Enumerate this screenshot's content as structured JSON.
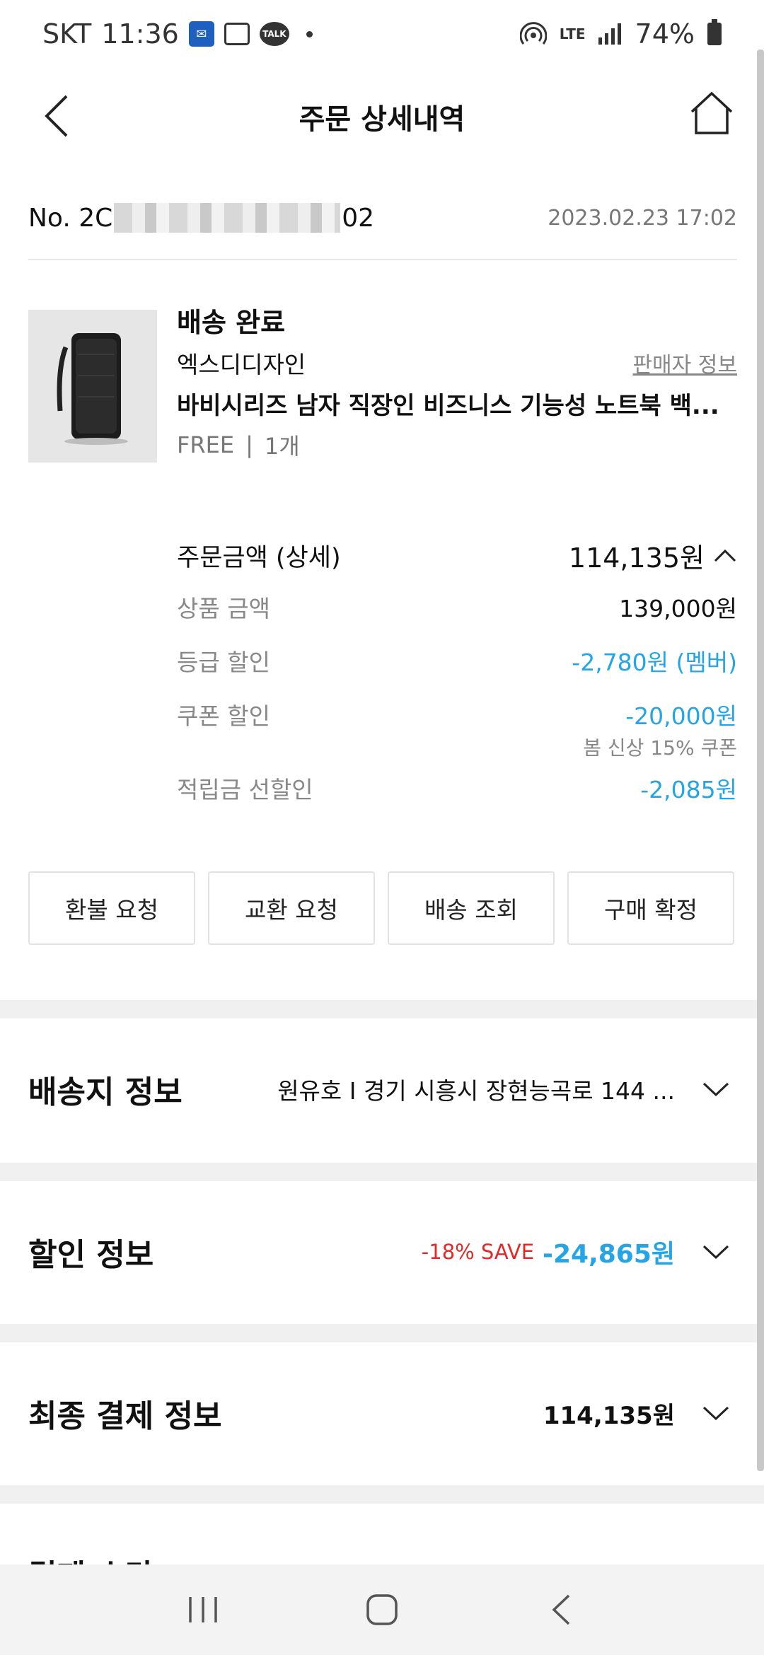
{
  "status_bar": {
    "carrier": "SKT",
    "time": "11:36",
    "talk_icon_label": "TALK",
    "network": "LTE",
    "battery": "74%"
  },
  "header": {
    "title": "주문 상세내역"
  },
  "order": {
    "number_prefix": "No. 2C",
    "number_suffix": "02",
    "date": "2023.02.23 17:02"
  },
  "product": {
    "status": "배송 완료",
    "brand": "엑스디디자인",
    "seller_link": "판매자 정보",
    "name": "바비시리즈 남자 직장인 비즈니스 기능성 노트북 백...",
    "option": "FREE",
    "separator": "|",
    "quantity": "1개"
  },
  "prices": {
    "order_amount_label": "주문금액 (상세)",
    "order_amount_value": "114,135원",
    "items": [
      {
        "label": "상품 금액",
        "value": "139,000원"
      },
      {
        "label": "등급 할인",
        "value": "-2,780원 (멤버)"
      },
      {
        "label": "쿠폰 할인",
        "value": "-20,000원"
      },
      {
        "label": "적립금 선할인",
        "value": "-2,085원"
      }
    ],
    "coupon_note": "봄 신상 15% 쿠폰"
  },
  "actions": [
    "환불 요청",
    "교환 요청",
    "배송 조회",
    "구매 확정"
  ],
  "sections": {
    "shipping": {
      "title": "배송지 정보",
      "value": "원유호  I  경기 시흥시 장현능곡로 144 ..."
    },
    "discount": {
      "title": "할인 정보",
      "save_tag": "-18% SAVE",
      "save_amount": "-24,865원"
    },
    "final_payment": {
      "title": "최종 결제 정보",
      "value": "114,135원"
    },
    "next_partial": {
      "title": "결제 수단"
    }
  },
  "colors": {
    "accent_blue": "#25a5e6",
    "save_red": "#e02a2a",
    "divider": "#f0f0f0"
  }
}
